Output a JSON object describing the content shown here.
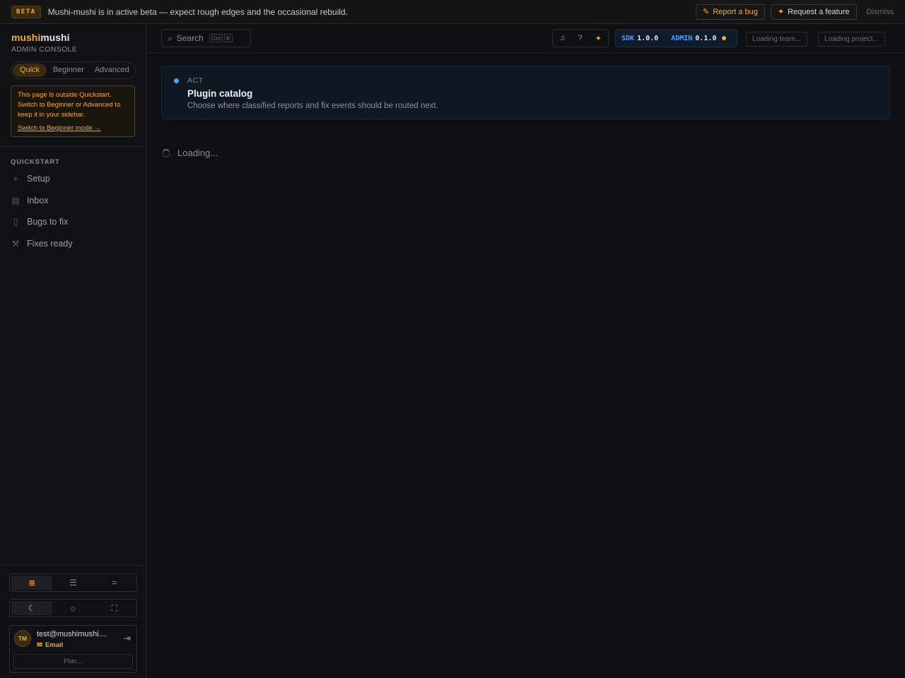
{
  "banner": {
    "badge": "BETA",
    "message": "Mushi-mushi is in active beta — expect rough edges and the occasional rebuild.",
    "report_bug": "Report a bug",
    "request_feature": "Request a feature",
    "dismiss": "Dismiss"
  },
  "sidebar": {
    "brand_a": "mushi",
    "brand_b": "mushi",
    "subtitle": "ADMIN CONSOLE",
    "modes": [
      "Quick",
      "Beginner",
      "Advanced"
    ],
    "active_mode": "Quick",
    "notice": {
      "text": "This page is outside Quickstart. Switch to Beginner or Advanced to keep it in your sidebar.",
      "link": "Switch to Beginner mode →"
    },
    "section_title": "QUICKSTART",
    "items": [
      {
        "label": "Setup",
        "icon": "plus-icon"
      },
      {
        "label": "Inbox",
        "icon": "inbox-icon"
      },
      {
        "label": "Bugs to fix",
        "icon": "document-icon"
      },
      {
        "label": "Fixes ready",
        "icon": "wrench-icon"
      }
    ],
    "density_options": [
      "compact",
      "comfortable",
      "spacious"
    ],
    "theme_options": [
      "dark",
      "light",
      "system"
    ],
    "user": {
      "initials": "TM",
      "email": "test@mushimushi....",
      "method": "Email",
      "plan_label": "Plan..."
    }
  },
  "topbar": {
    "search_placeholder": "Search",
    "shortcut_keys": [
      "Ctrl",
      "K"
    ],
    "sdk_label": "SDK",
    "sdk_version": "1.0.0",
    "admin_label": "ADMIN",
    "admin_version": "0.1.0",
    "team_loading": "Loading team...",
    "project_loading": "Loading project..."
  },
  "main": {
    "tag": "ACT",
    "title": "Plugin catalog",
    "description": "Choose where classified reports and fix events should be routed next.",
    "loading": "Loading..."
  },
  "colors": {
    "accent": "#f2a93b",
    "background": "#0f1014",
    "info": "#4da6f0"
  }
}
